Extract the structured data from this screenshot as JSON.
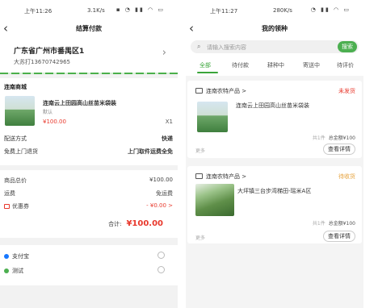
{
  "left": {
    "status_time": "上午11:26",
    "status_net": "3.1K/s",
    "page_title": "结算付款",
    "address": {
      "line1": "广东省广州市番禺区1",
      "line2": "大苏打13670742965"
    },
    "shop_name": "连南商城",
    "product": {
      "name": "连南云上田园高山丝苗米袋装",
      "spec": "默认",
      "price": "¥100.00",
      "qty": "X1"
    },
    "delivery": {
      "label": "配送方式",
      "value": "快递"
    },
    "return": {
      "label": "免费上门退货",
      "value": "上门取件运费全免"
    },
    "summary": {
      "goods_label": "商品总价",
      "goods_value": "¥100.00",
      "freight_label": "运费",
      "freight_value": "免运费",
      "coupon_label": "优惠券",
      "coupon_value": "- ¥0.00 >",
      "total_label": "合计:",
      "total_value": "¥100.00"
    },
    "payments": [
      {
        "label": "支付宝",
        "color": "#1677ff"
      },
      {
        "label": "测试",
        "color": "#4caf50"
      }
    ]
  },
  "right": {
    "status_time": "上午11:27",
    "status_net": "280K/s",
    "page_title": "我的领种",
    "search": {
      "placeholder": "请输入搜索内容",
      "button": "搜索"
    },
    "tabs": [
      "全部",
      "待付款",
      "耕种中",
      "寄送中",
      "待评价"
    ],
    "orders": [
      {
        "store": "连南农特产品 >",
        "status": "未发货",
        "product": "连南云上田园高山丝苗米袋装",
        "count": "共1件",
        "total": "总金额¥100",
        "more": "更多",
        "detail": "查看详情"
      },
      {
        "store": "连南农特产品 >",
        "status": "待收货",
        "product": "大坪镇三台步湾梯田-瑶米A区",
        "count": "共1件",
        "total": "总金额¥100",
        "more": "更多",
        "detail": "查看详情"
      }
    ]
  }
}
